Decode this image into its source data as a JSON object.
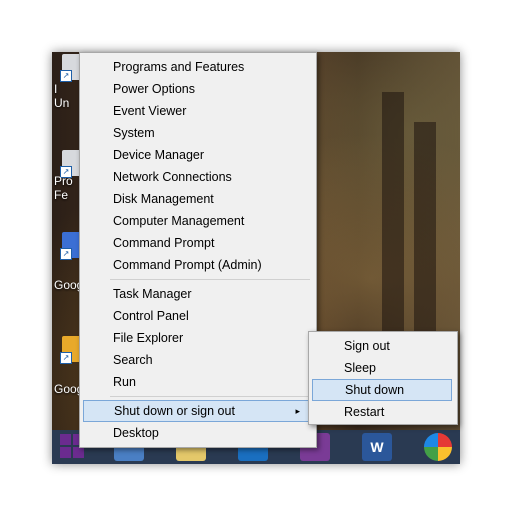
{
  "desktop": {
    "icons": [
      {
        "label": "I\nUn",
        "icon": "shortcut-icon"
      },
      {
        "label": "Pro\nFe",
        "icon": "shortcut-icon"
      },
      {
        "label": "Goog",
        "icon": "shortcut-icon"
      },
      {
        "label": "Goog",
        "icon": "shortcut-icon"
      }
    ]
  },
  "context_menu": {
    "groups": [
      [
        "Programs and Features",
        "Power Options",
        "Event Viewer",
        "System",
        "Device Manager",
        "Network Connections",
        "Disk Management",
        "Computer Management",
        "Command Prompt",
        "Command Prompt (Admin)"
      ],
      [
        "Task Manager",
        "Control Panel",
        "File Explorer",
        "Search",
        "Run"
      ],
      [
        "Shut down or sign out",
        "Desktop"
      ]
    ],
    "highlighted": "Shut down or sign out",
    "submenu_arrow": "▸"
  },
  "submenu": {
    "items": [
      "Sign out",
      "Sleep",
      "Shut down",
      "Restart"
    ],
    "highlighted": "Shut down"
  },
  "taskbar": {
    "icons": [
      "start-icon",
      "calendar-icon",
      "file-explorer-icon",
      "outlook-icon",
      "onenote-icon",
      "word-icon",
      "picasa-icon"
    ]
  },
  "colors": {
    "highlight": "#d5e5f5",
    "highlight_border": "#7ba7d8",
    "menu_bg": "#f0f0f0",
    "taskbar": "#2a3a52"
  }
}
